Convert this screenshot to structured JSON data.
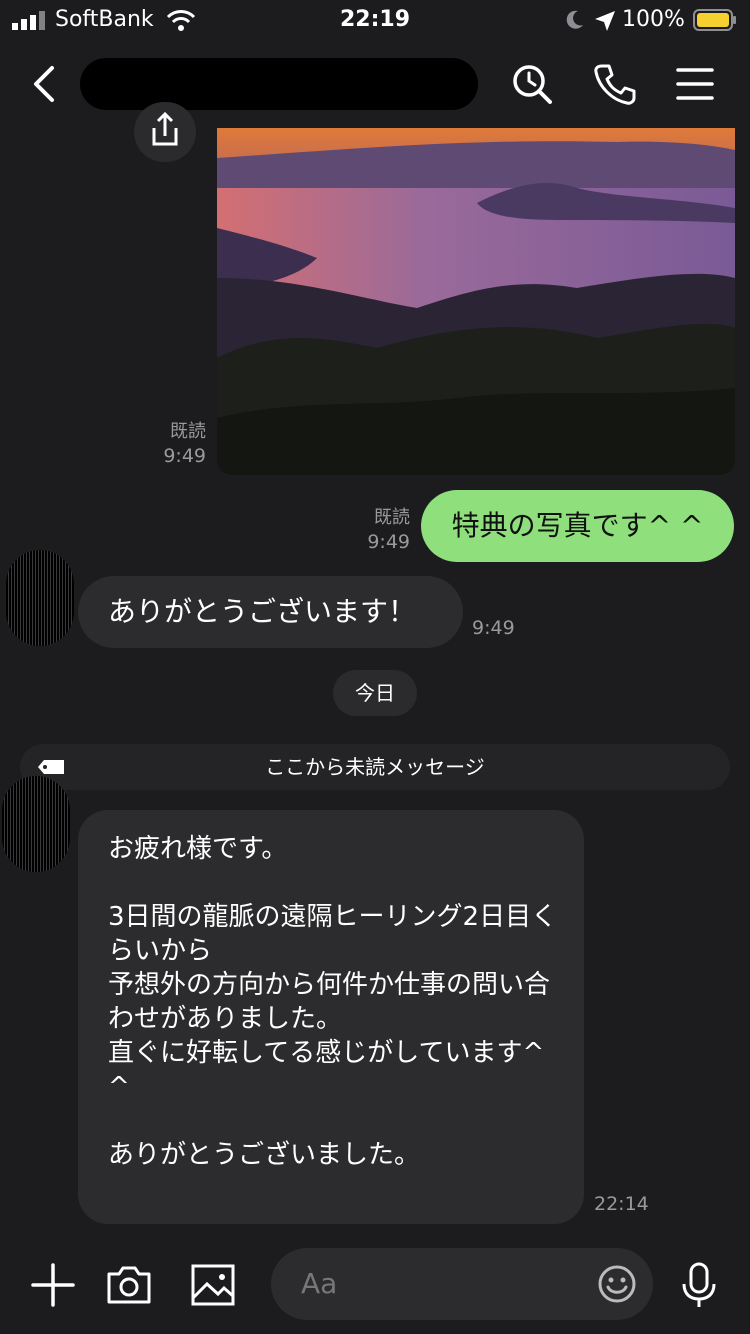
{
  "status_bar": {
    "carrier": "SoftBank",
    "time": "22:19",
    "battery": "100%"
  },
  "header": {
    "title": ""
  },
  "messages": {
    "photo_meta": {
      "read": "既読",
      "time": "9:49"
    },
    "outgoing": {
      "text": "特典の写真です^ ^",
      "read": "既読",
      "time": "9:49"
    },
    "incoming1": {
      "text": "ありがとうございます！",
      "time": "9:49"
    },
    "date_separator": "今日",
    "unread_banner": "ここから未読メッセージ",
    "incoming2": {
      "text": "お疲れ様です。\n\n3日間の龍脈の遠隔ヒーリング2日目くらいから\n予想外の方向から何件か仕事の問い合わせがありました。\n直ぐに好転してる感じがしています^ ^\n\nありがとうございました。",
      "time": "22:14"
    }
  },
  "input_bar": {
    "placeholder": "Aa"
  },
  "colors": {
    "bubble_out": "#8fe07c",
    "bubble_in": "#2c2c2e",
    "background": "#1c1c1e",
    "battery": "#f5d130"
  }
}
